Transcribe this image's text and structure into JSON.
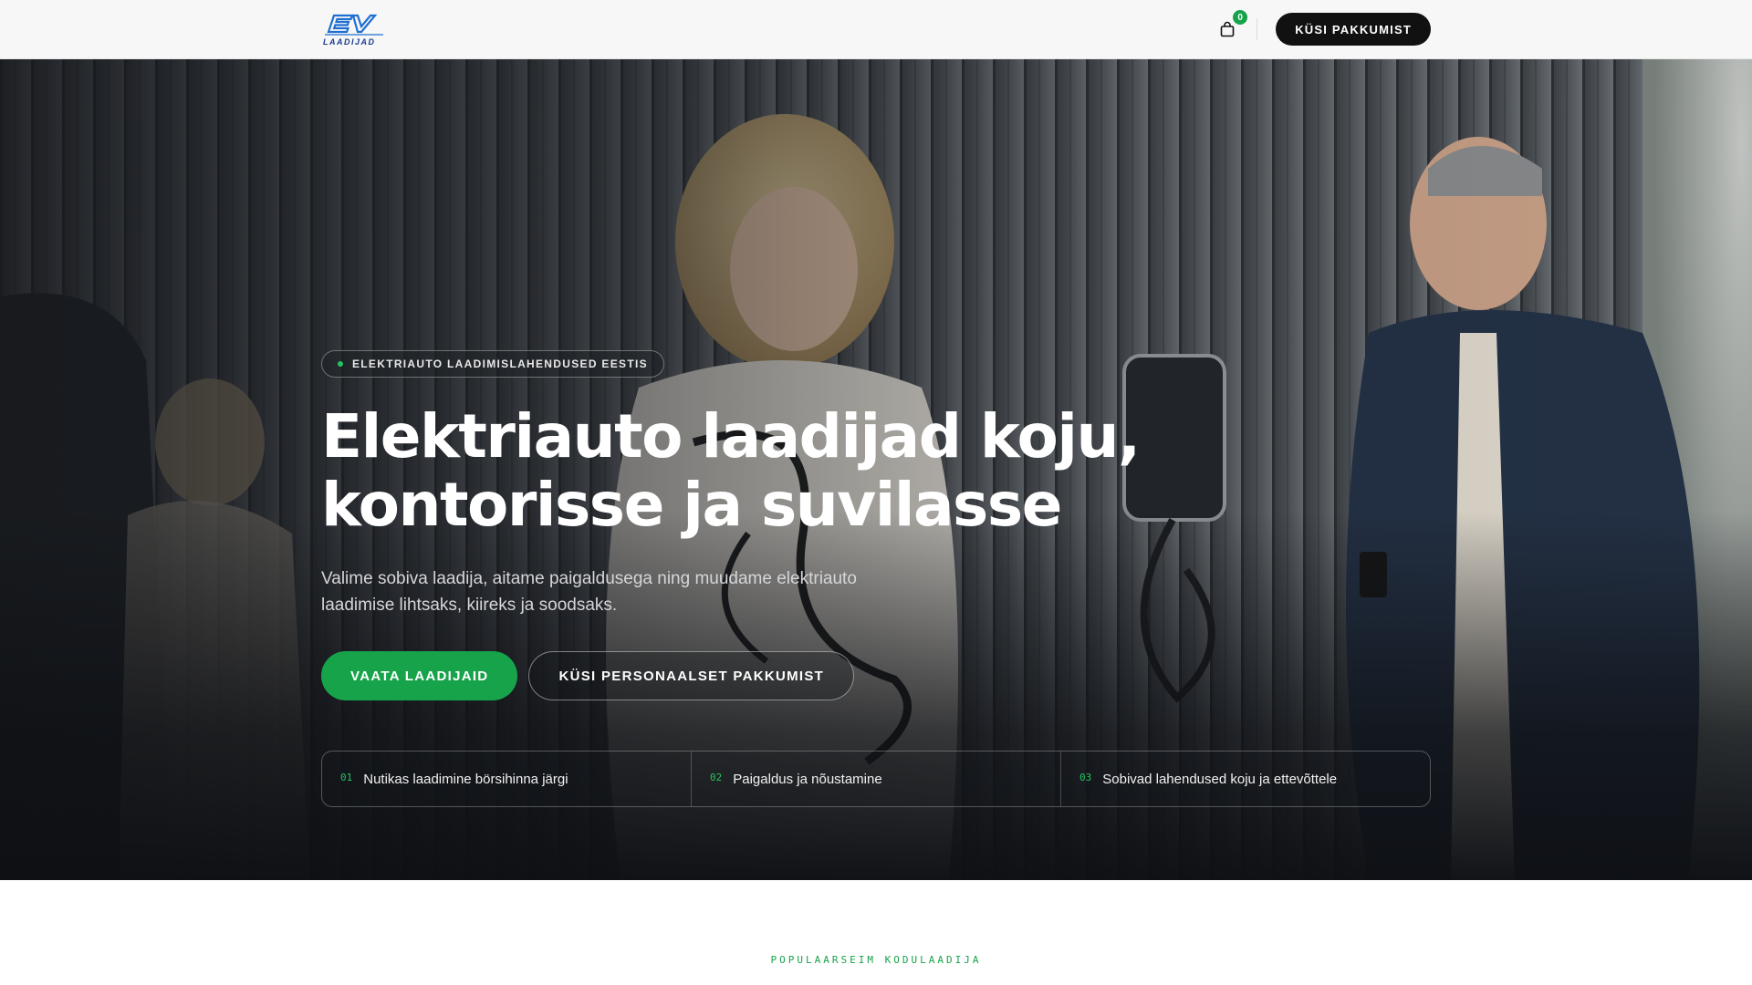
{
  "header": {
    "logo_text": "EV",
    "logo_sub": "LAADIJAD",
    "cart_count": "0",
    "cta_label": "KÜSI PAKKUMIST"
  },
  "hero": {
    "badge": "ELEKTRIAUTO LAADIMISLAHENDUSED EESTIS",
    "title_line1": "Elektriauto laadijad koju,",
    "title_line2": "kontorisse ja suvilasse",
    "subtitle": "Valime sobiva laadija, aitame paigaldusega ning muudame elektriauto laadimise lihtsaks, kiireks ja soodsaks.",
    "primary_cta": "VAATA LAADIJAID",
    "secondary_cta": "KÜSI PERSONAALSET PAKKUMIST",
    "features": [
      {
        "num": "01",
        "label": "Nutikas laadimine börsihinna järgi"
      },
      {
        "num": "02",
        "label": "Paigaldus ja nõustamine"
      },
      {
        "num": "03",
        "label": "Sobivad lahendused koju ja ettevõttele"
      }
    ]
  },
  "section": {
    "eyebrow": "POPULAARSEIM KODULAADIJA"
  },
  "colors": {
    "accent": "#16a34a",
    "header_bg": "#f7f7f8",
    "hero_dark": "#14161a",
    "logo_blue": "#1f6fd1"
  },
  "icons": {
    "cart": "shopping-bag-icon",
    "badge_dot": "status-dot-icon"
  }
}
